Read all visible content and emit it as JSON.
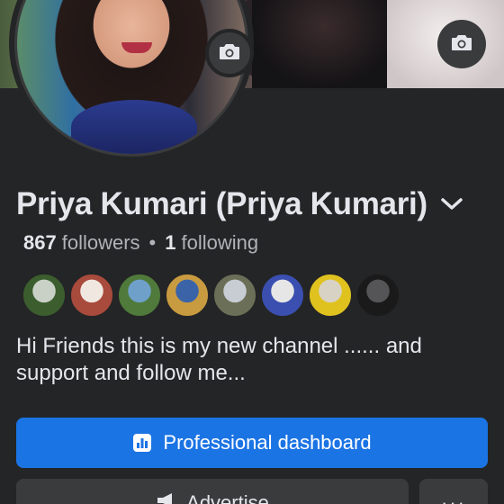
{
  "profile": {
    "name": "Priya Kumari  (Priya Kumari)",
    "followers_count": "867",
    "followers_label": "followers",
    "separator": "•",
    "following_count": "1",
    "following_label": "following",
    "bio": "Hi Friends this is my new channel ...... and support and follow me..."
  },
  "icons": {
    "cover_camera": "camera-icon",
    "avatar_camera": "camera-icon",
    "name_dropdown": "chevron-down-icon",
    "dashboard": "bar-chart-icon",
    "advertise": "megaphone-icon"
  },
  "friends": [
    {
      "colors": [
        "#c9d1c6",
        "#3c5e2f"
      ]
    },
    {
      "colors": [
        "#f1e7e1",
        "#a84a3c"
      ]
    },
    {
      "colors": [
        "#6fa0c9",
        "#4f7a3b"
      ]
    },
    {
      "colors": [
        "#3b63a8",
        "#c99b40"
      ]
    },
    {
      "colors": [
        "#c7cdd3",
        "#6b6f57"
      ]
    },
    {
      "colors": [
        "#e6e6e6",
        "#3a4fb0"
      ]
    },
    {
      "colors": [
        "#d8d2c4",
        "#e0c21f"
      ]
    },
    {
      "colors": [
        "#555557",
        "#1a1a1a"
      ]
    }
  ],
  "actions": {
    "dashboard_label": "Professional dashboard",
    "advertise_label": "Advertise",
    "more_label": "···"
  },
  "colors": {
    "background": "#242526",
    "primary_button": "#1b74e4",
    "secondary_button": "#3a3b3c",
    "text_primary": "#e4e6eb",
    "text_secondary": "#b0b3b8"
  }
}
